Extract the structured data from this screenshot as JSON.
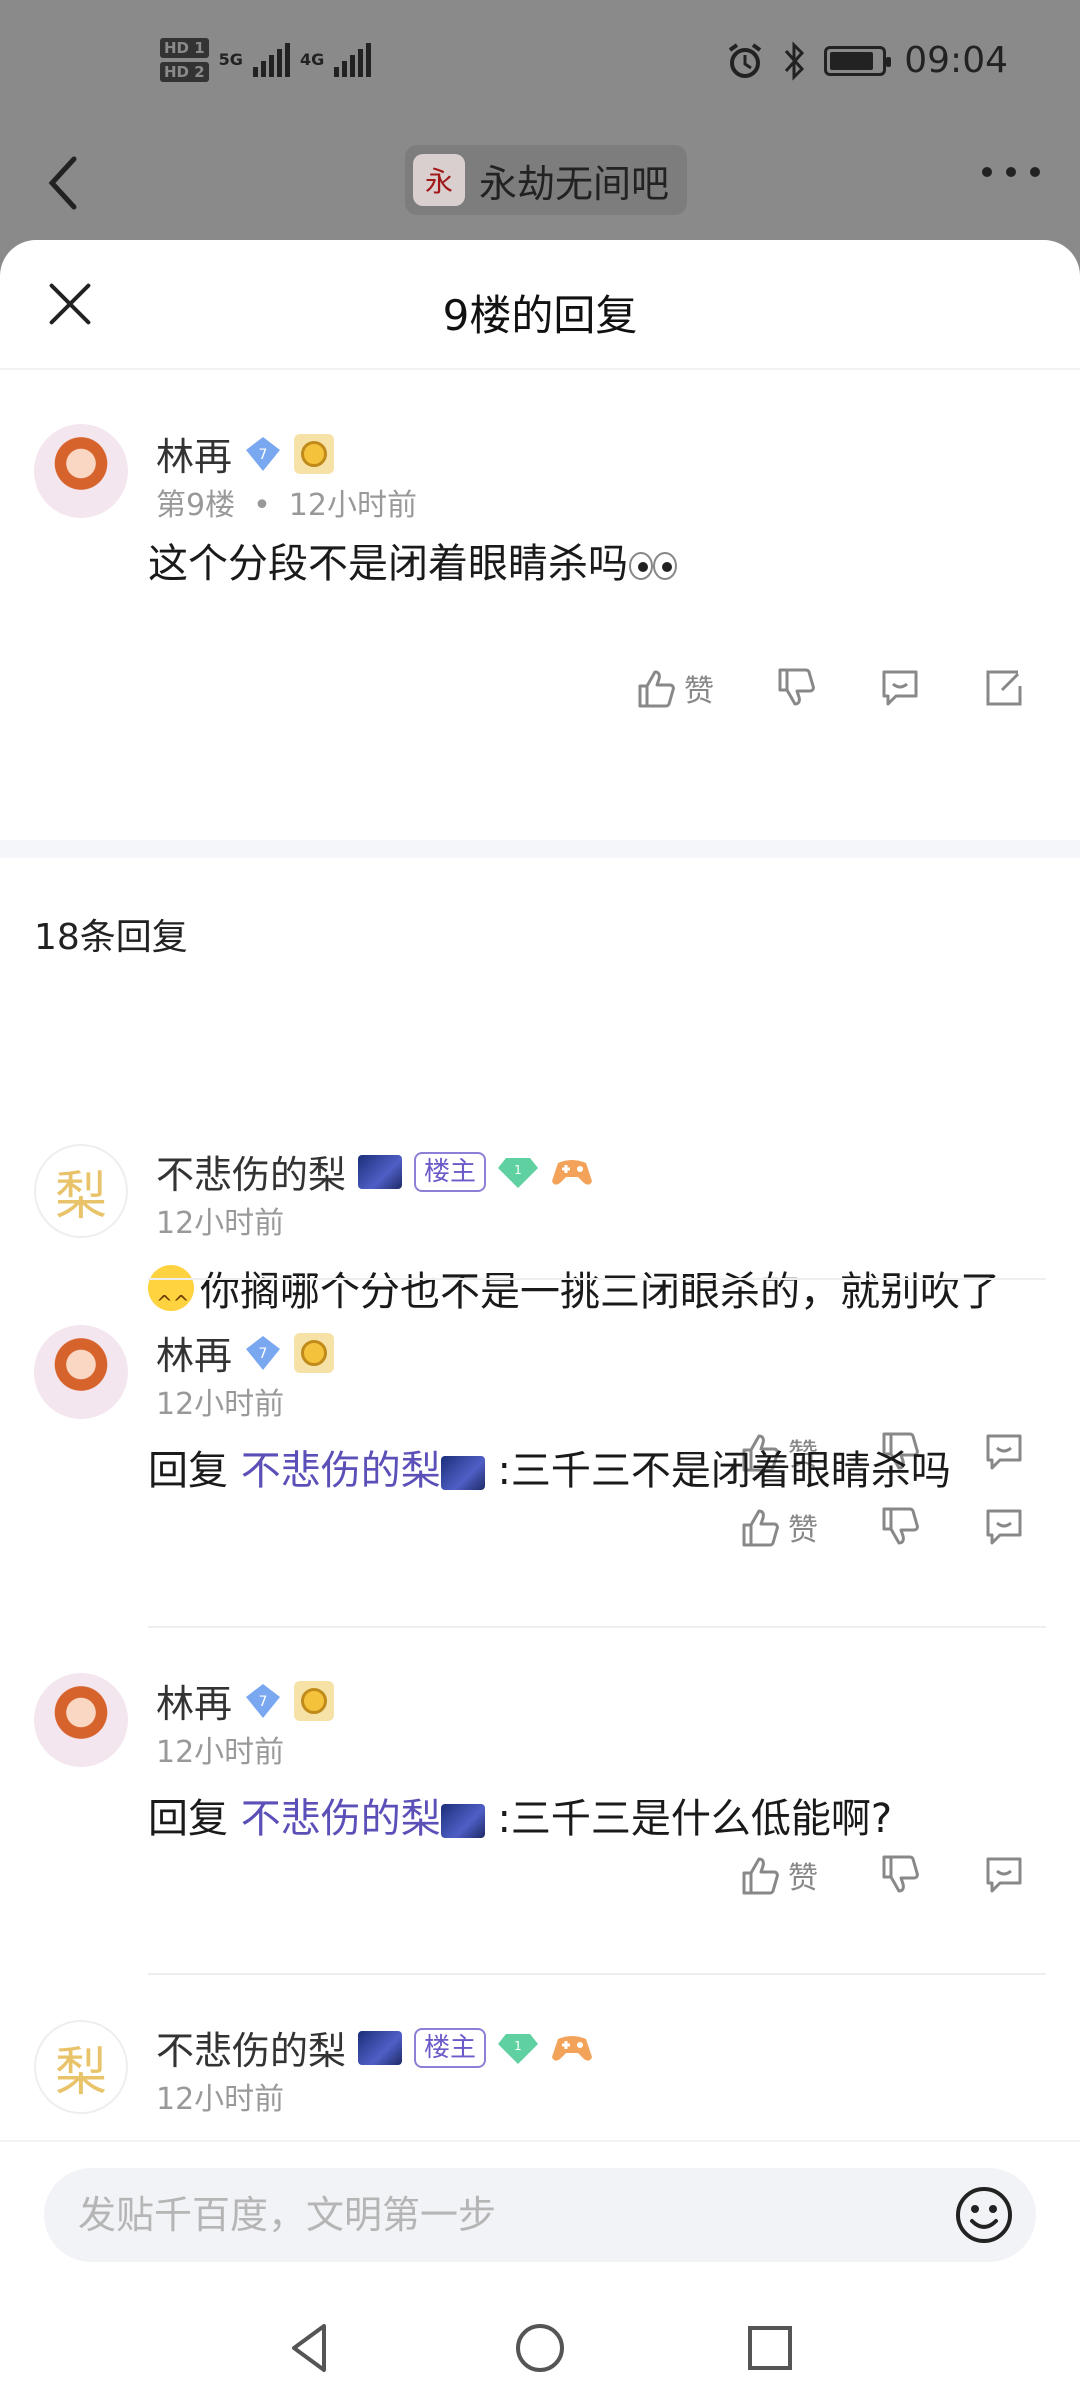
{
  "status_bar": {
    "hd1": "HD 1",
    "hd2": "HD 2",
    "net1": "5G",
    "net2": "4G",
    "time": "09:04",
    "battery_level": 0.85
  },
  "header": {
    "forum_name": "永劫无间吧",
    "forum_logo_text": "永"
  },
  "sheet": {
    "title": "9楼的回复"
  },
  "post": {
    "username": "林再",
    "level": "7",
    "floor": "第9楼",
    "dot": "•",
    "time": "12小时前",
    "text": "这个分段不是闭着眼睛杀吗",
    "like_label": "赞"
  },
  "replies_count": "18条回复",
  "replies": [
    {
      "username": "不悲伤的梨",
      "avatar_text": "梨",
      "owner_badge": "楼主",
      "gem_level": "1",
      "time": "12小时前",
      "text": "你搁哪个分也不是一挑三闭眼杀的，就别吹了",
      "like_label": "赞"
    },
    {
      "username": "林再",
      "level": "7",
      "time": "12小时前",
      "reply_prefix": "回复",
      "reply_to": "不悲伤的梨",
      "text": ":三千三不是闭着眼睛杀吗",
      "like_label": "赞"
    },
    {
      "username": "林再",
      "level": "7",
      "time": "12小时前",
      "reply_prefix": "回复",
      "reply_to": "不悲伤的梨",
      "text": ":三千三是什么低能啊?",
      "like_label": "赞"
    },
    {
      "username": "不悲伤的梨",
      "avatar_text": "梨",
      "owner_badge": "楼主",
      "gem_level": "1",
      "time": "12小时前"
    }
  ],
  "input": {
    "placeholder": "发贴千百度，文明第一步"
  },
  "colors": {
    "accent": "#5b4fb8",
    "sheet_bg": "#ffffff",
    "overlay": "#8a8a8a"
  }
}
